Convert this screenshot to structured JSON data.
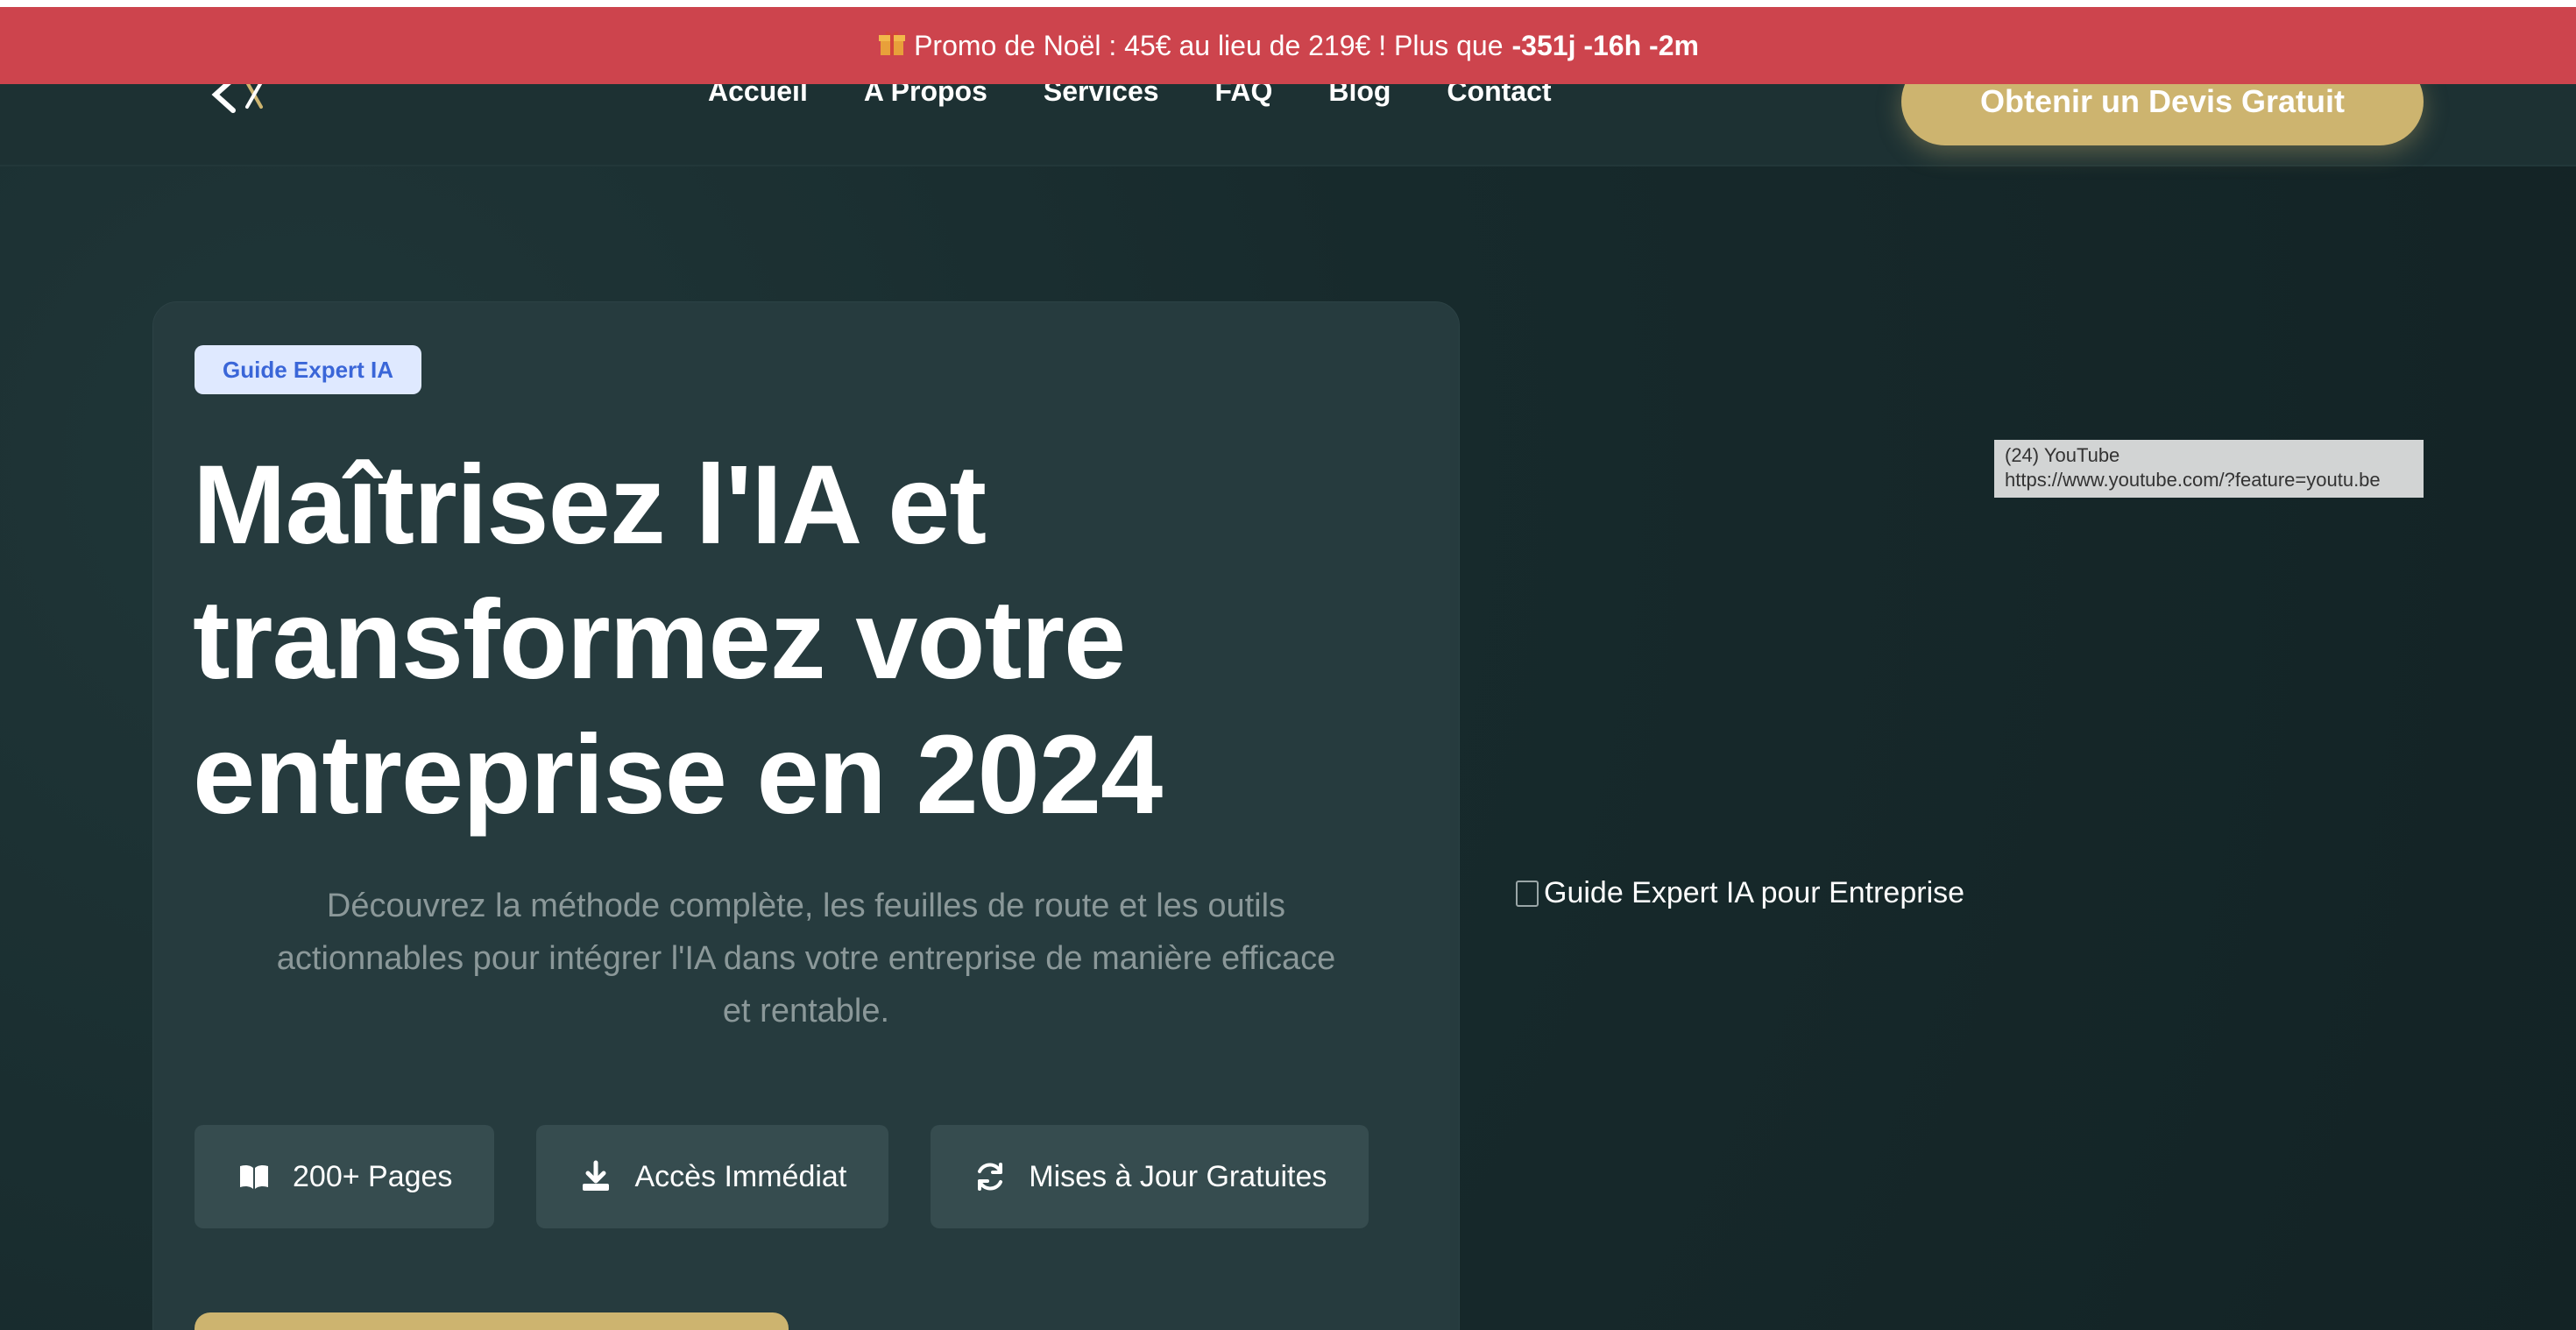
{
  "promo": {
    "icon": "gift-icon",
    "text": "Promo de Noël : 45€ au lieu de 219€ ! Plus que",
    "countdown": "-351j -16h -2m"
  },
  "nav": {
    "items": [
      "Accueil",
      "A Propos",
      "Services",
      "FAQ",
      "Blog",
      "Contact"
    ],
    "cta": "Obtenir un Devis Gratuit"
  },
  "hero": {
    "badge": "Guide Expert IA",
    "title_lines": [
      "Maîtrisez l'IA et",
      "transformez votre",
      "entreprise en 2024"
    ],
    "description": "Découvrez la méthode complète, les feuilles de route et les outils actionnables pour intégrer l'IA dans votre entreprise de manière efficace et rentable.",
    "features": [
      {
        "icon": "book-open-icon",
        "label": "200+ Pages"
      },
      {
        "icon": "download-icon",
        "label": "Accès Immédiat"
      },
      {
        "icon": "refresh-icon",
        "label": "Mises à Jour Gratuites"
      }
    ]
  },
  "tooltip": {
    "line1": "(24) YouTube",
    "line2": "https://www.youtube.com/?feature=youtu.be"
  },
  "image": {
    "alt": "Guide Expert IA pour Entreprise"
  },
  "colors": {
    "promo_bg": "#cd444d",
    "accent_gold": "#cdb46f",
    "badge_text": "#3a66d8",
    "background": "#17282a"
  }
}
